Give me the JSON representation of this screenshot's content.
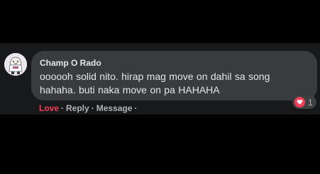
{
  "comment": {
    "author": "Champ O Rado",
    "text": "oooooh solid nito. hirap mag move on dahil sa song hahaha. buti naka move on pa HAHAHA",
    "avatar_icon": "sticker-avatar-icon",
    "reaction": {
      "icon": "heart-icon",
      "count": "1",
      "color": "#f33e58"
    },
    "actions": {
      "love_label": "Love",
      "reply_label": "Reply",
      "message_label": "Message",
      "separator": "·"
    }
  },
  "colors": {
    "page_background": "#000000",
    "panel_background": "#18191a",
    "bubble_background": "#3a3b3c",
    "primary_text": "#e4e6eb",
    "secondary_text": "#b0b3b8",
    "love_accent": "#f33e58"
  }
}
